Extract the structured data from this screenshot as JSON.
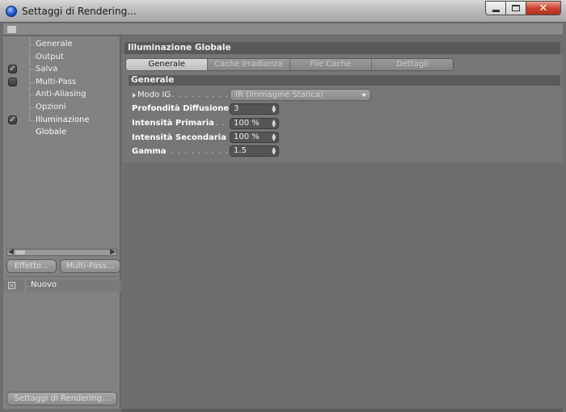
{
  "window": {
    "title": "Settaggi di Rendering..."
  },
  "sidebar": {
    "items": [
      {
        "label": "Generale",
        "checkbox": false,
        "checked": false
      },
      {
        "label": "Output",
        "checkbox": false,
        "checked": false
      },
      {
        "label": "Salva",
        "checkbox": true,
        "checked": true
      },
      {
        "label": "Multi-Pass",
        "checkbox": true,
        "checked": false
      },
      {
        "label": "Anti-Aliasing",
        "checkbox": false,
        "checked": false
      },
      {
        "label": "Opzioni",
        "checkbox": false,
        "checked": false
      },
      {
        "label": "Illuminazione Globale",
        "checkbox": true,
        "checked": true
      }
    ],
    "buttons": {
      "effect": "Effetto...",
      "multipass": "Multi-Pass..."
    },
    "post_effects": [
      {
        "label": "Nuovo"
      }
    ],
    "render_settings_button": "Settaggi di Rendering..."
  },
  "main": {
    "section_title": "Illuminazione Globale",
    "tabs": [
      {
        "label": "Generale",
        "active": true
      },
      {
        "label": "Cache Irradianza",
        "active": false
      },
      {
        "label": "File Cache Irradianza",
        "active": false
      },
      {
        "label": "Dettagli",
        "active": false
      }
    ],
    "group_title": "Generale",
    "params": {
      "mode": {
        "label": "Modo IG",
        "dots": ". . . . . . . . . . . .",
        "value": "IR (Immagine Statica)"
      },
      "diffuse_depth": {
        "label": "Profondità Diffusione",
        "value": "3"
      },
      "primary_intensity": {
        "label": "Intensità Primaria",
        "dots": ". . .",
        "value": "100 %"
      },
      "secondary_intensity": {
        "label": "Intensità Secondaria",
        "value": "100 %"
      },
      "gamma": {
        "label": "Gamma",
        "dots": ". . . . . . . . . . . . .",
        "value": "1.5"
      }
    }
  },
  "icons": {
    "app": "cinema4d-app-icon",
    "spinner": "spinner-arrows-icon"
  }
}
